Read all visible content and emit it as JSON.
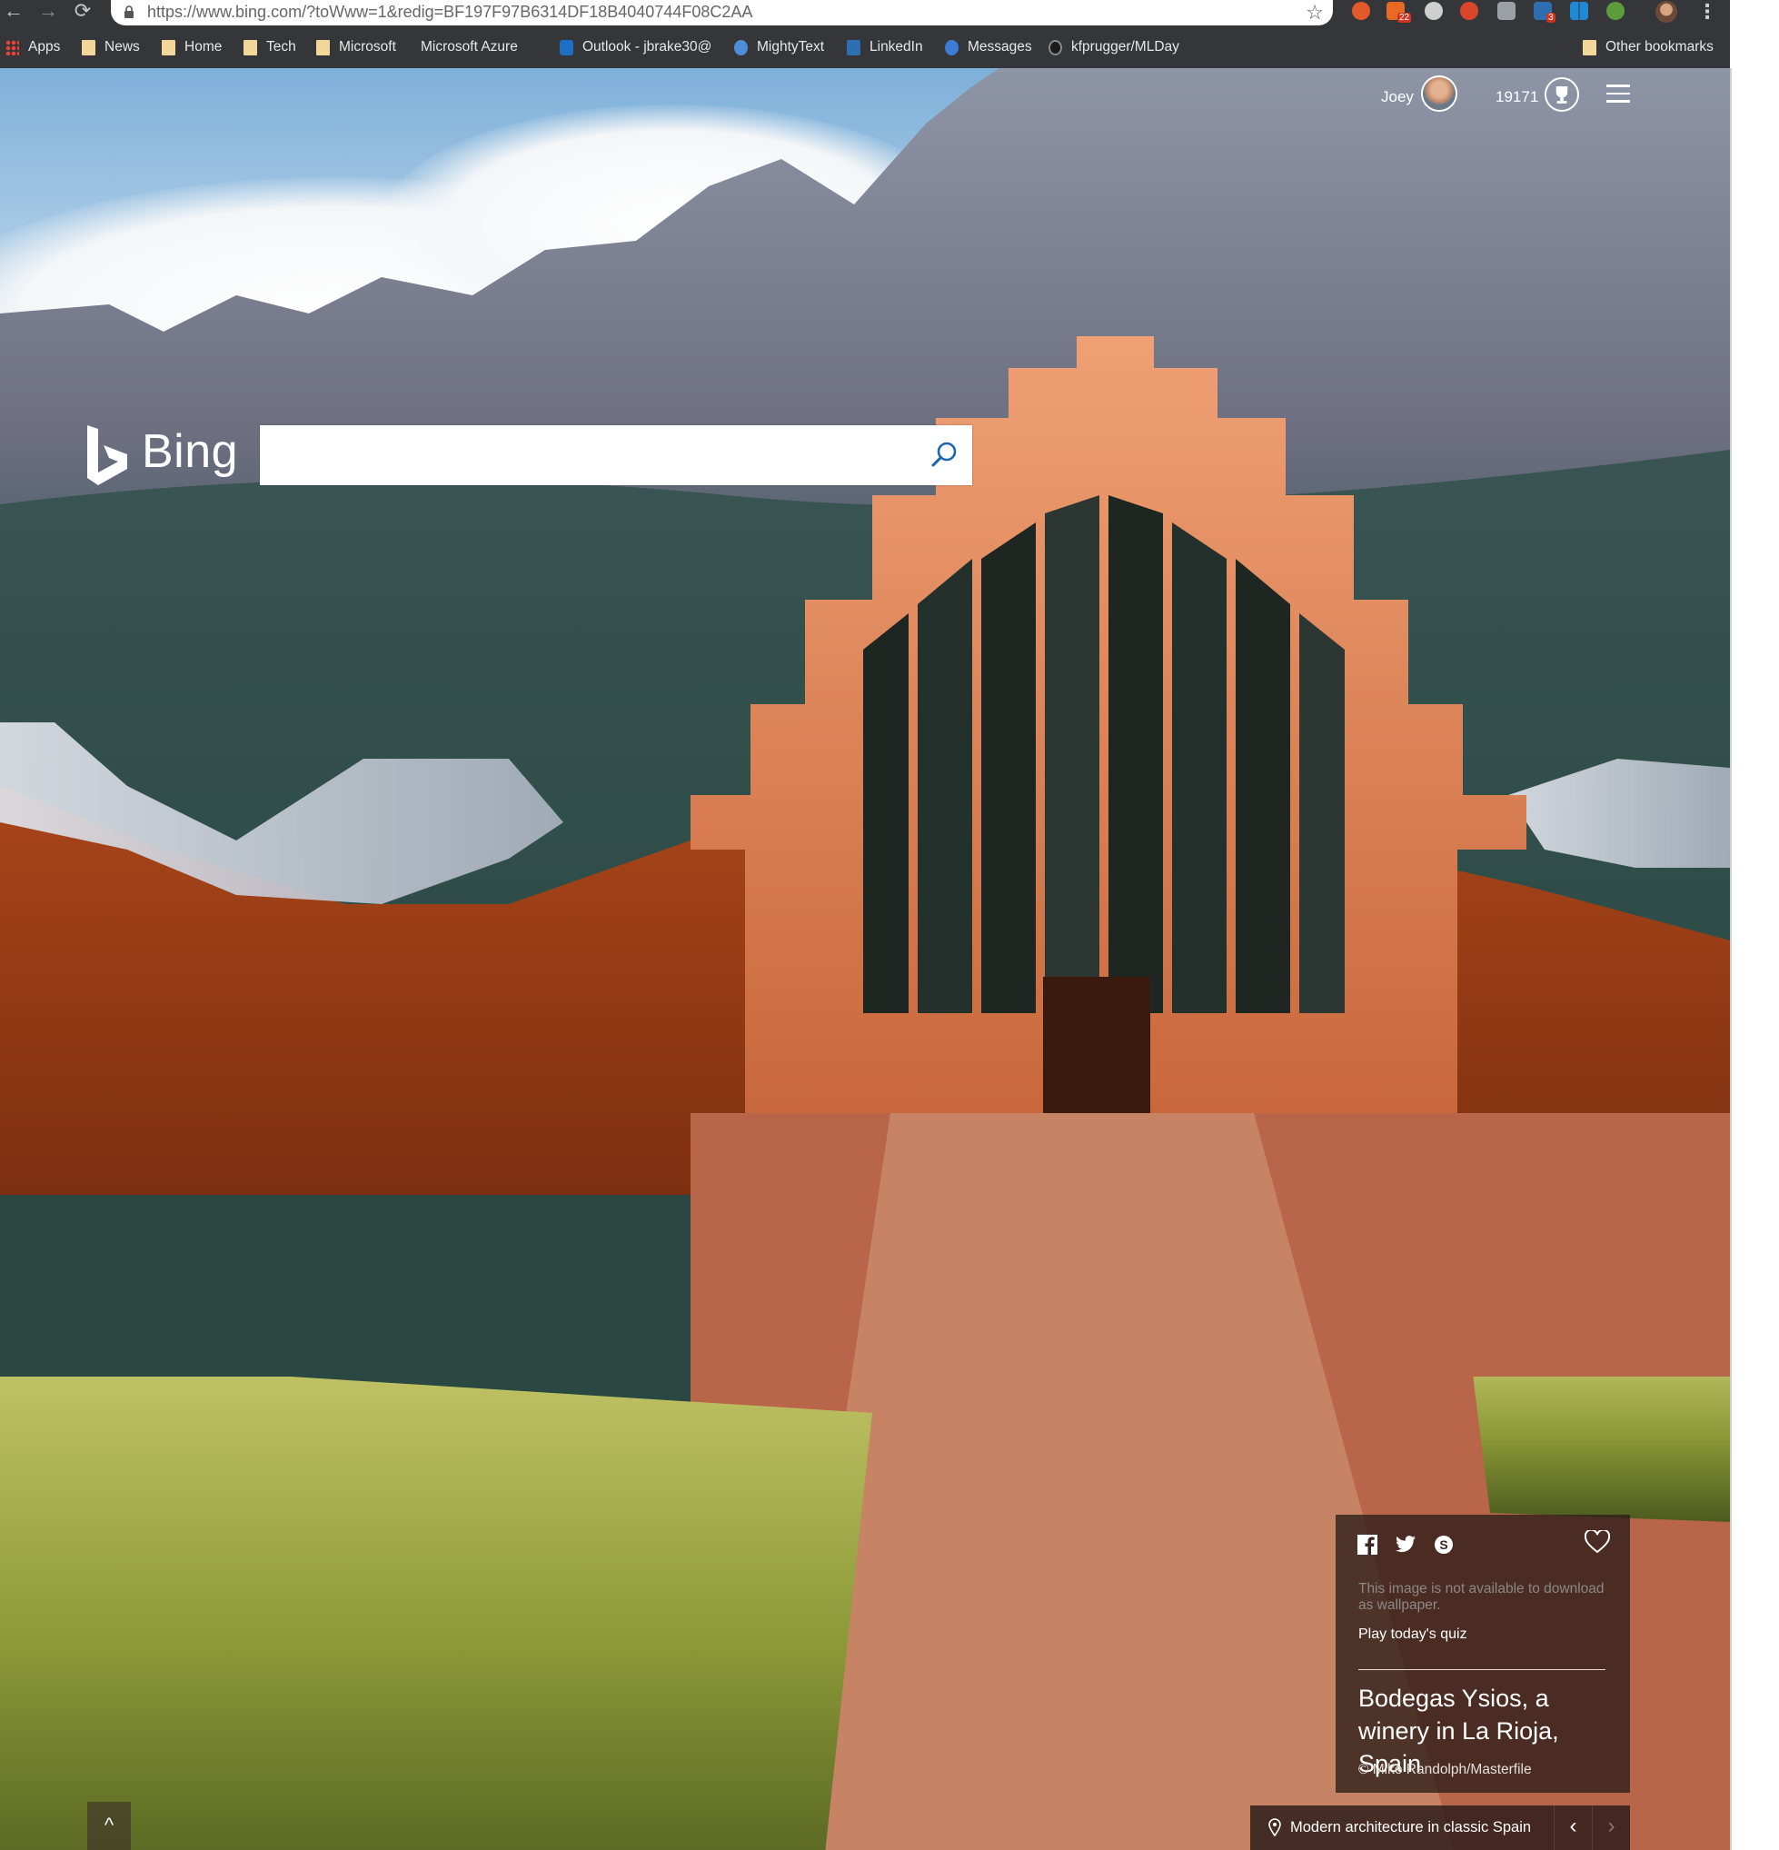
{
  "browser": {
    "url": "https://www.bing.com/?toWww=1&redig=BF197F97B6314DF18B4040744F08C2AA",
    "extensions_badges": [
      "22",
      "3"
    ]
  },
  "bookmarks": {
    "items": [
      {
        "label": "Apps",
        "icon": "apps-grid-icon"
      },
      {
        "label": "News",
        "icon": "folder-icon"
      },
      {
        "label": "Home",
        "icon": "folder-icon"
      },
      {
        "label": "Tech",
        "icon": "folder-icon"
      },
      {
        "label": "Microsoft",
        "icon": "folder-icon"
      },
      {
        "label": "Microsoft Azure",
        "icon": "page-icon"
      },
      {
        "label": "Outlook - jbrake30@",
        "icon": "outlook-icon"
      },
      {
        "label": "MightyText",
        "icon": "mightytext-icon"
      },
      {
        "label": "LinkedIn",
        "icon": "linkedin-icon"
      },
      {
        "label": "Messages",
        "icon": "messages-icon"
      },
      {
        "label": "kfprugger/MLDay",
        "icon": "github-icon"
      }
    ],
    "other": "Other bookmarks"
  },
  "header": {
    "user_name": "Joey",
    "reward_points": "19171"
  },
  "brand": {
    "logo_text": "Bing"
  },
  "search": {
    "value": "",
    "placeholder": ""
  },
  "image_card": {
    "share_icons": [
      "facebook-icon",
      "twitter-icon",
      "skype-icon"
    ],
    "wallpaper_note": "This image is not available to download as wallpaper.",
    "quiz_link": "Play today's quiz",
    "title": "Bodegas Ysios, a winery in La Rioja, Spain",
    "credit": "© Mike Randolph/Masterfile"
  },
  "caption_bar": {
    "text": "Modern architecture in classic Spain",
    "prev": "‹",
    "next": "›"
  },
  "scroll_up": "^",
  "colors": {
    "chrome": "#35363a",
    "card_bg": "#2c1c18",
    "rust": "#b8501f",
    "copper": "#e98a5c"
  }
}
